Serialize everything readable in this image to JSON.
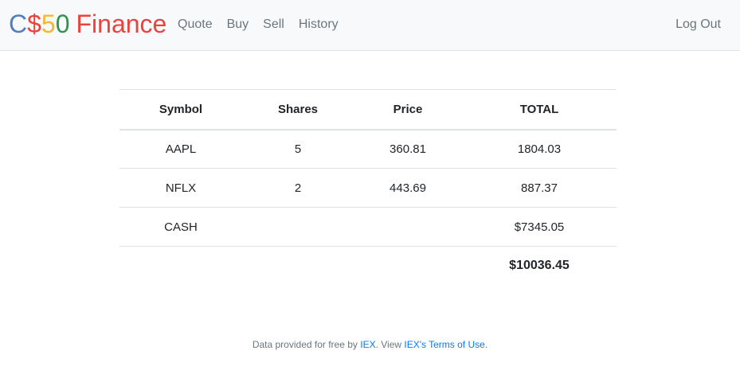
{
  "brand": {
    "c": "C",
    "dollar": "$",
    "five": "5",
    "zero": "0",
    "finance": "Finance",
    "colors": {
      "blue": "#537fbe",
      "red": "#ea433b",
      "yellow": "#f5b82e",
      "green": "#2e944b"
    }
  },
  "nav": {
    "links": [
      "Quote",
      "Buy",
      "Sell",
      "History"
    ],
    "logout": "Log Out"
  },
  "table": {
    "headers": [
      "Symbol",
      "Shares",
      "Price",
      "TOTAL"
    ],
    "rows": [
      {
        "symbol": "AAPL",
        "shares": "5",
        "price": "360.81",
        "total": "1804.03"
      },
      {
        "symbol": "NFLX",
        "shares": "2",
        "price": "443.69",
        "total": "887.37"
      }
    ],
    "cash": {
      "label": "CASH",
      "value": "$7345.05"
    },
    "grand_total": "$10036.45"
  },
  "footer": {
    "prefix": "Data provided for free by ",
    "iex_link": "IEX",
    "middle": ". View ",
    "terms_link": "IEX's Terms of Use",
    "suffix": "."
  }
}
